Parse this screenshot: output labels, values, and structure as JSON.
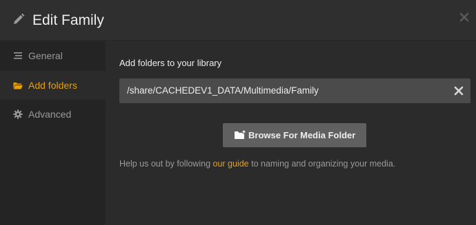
{
  "dialog": {
    "title": "Edit Family",
    "pencil_icon": "pencil-icon",
    "close_icon": "close-icon"
  },
  "sidebar": {
    "items": [
      {
        "label": "General",
        "icon": "list-icon",
        "active": false
      },
      {
        "label": "Add folders",
        "icon": "folder-open-icon",
        "active": true
      },
      {
        "label": "Advanced",
        "icon": "gear-icon",
        "active": false
      }
    ]
  },
  "main": {
    "section_title": "Add folders to your library",
    "folder_path": "/share/CACHEDEV1_DATA/Multimedia/Family",
    "browse_label": "Browse For Media Folder",
    "help": {
      "before": "Help us out by following ",
      "link": "our guide",
      "after": " to naming and organizing your media."
    }
  },
  "colors": {
    "accent": "#e5a00d",
    "background": "#2b2b2b",
    "sidebar": "#242424",
    "field": "#4b4b4b",
    "button": "#606060"
  }
}
